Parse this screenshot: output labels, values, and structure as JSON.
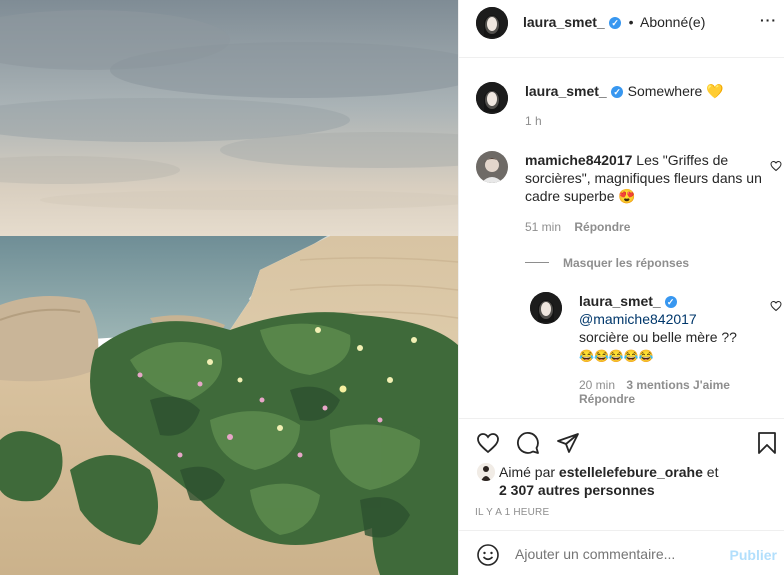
{
  "header": {
    "username": "laura_smet_",
    "separator": "•",
    "follow_status": "Abonné(e)",
    "more": "···"
  },
  "caption": {
    "username": "laura_smet_",
    "text": "Somewhere 💛",
    "time": "1 h"
  },
  "comments": [
    {
      "username": "mamiche842017",
      "text": " Les \"Griffes de sorcières\", magnifiques fleurs dans un cadre superbe 😍",
      "time": "51 min",
      "reply_label": "Répondre"
    }
  ],
  "replies_toggle": "Masquer les réponses",
  "reply": {
    "username": "laura_smet_",
    "mention": "@mamiche842017",
    "text": "sorcière ou belle mère ??",
    "emojis": "😂😂😂😂😂",
    "time": "20 min",
    "likes": "3 mentions J'aime",
    "reply_label": "Répondre"
  },
  "likes": {
    "prefix": "Aimé par ",
    "user": "estellelefebure_orahe",
    "middle": " et",
    "others": "2 307 autres personnes"
  },
  "timestamp": "IL Y A 1 HEURE",
  "add_comment": {
    "placeholder": "Ajouter un commentaire...",
    "publish": "Publier"
  },
  "colors": {
    "verified": "#3897f0",
    "link": "#00376b",
    "publish_disabled": "#b2dffc",
    "secondary": "#8e8e8e"
  },
  "icons": [
    "heart-icon",
    "comment-icon",
    "share-icon",
    "bookmark-icon",
    "emoji-icon",
    "more-icon",
    "verified-icon"
  ]
}
